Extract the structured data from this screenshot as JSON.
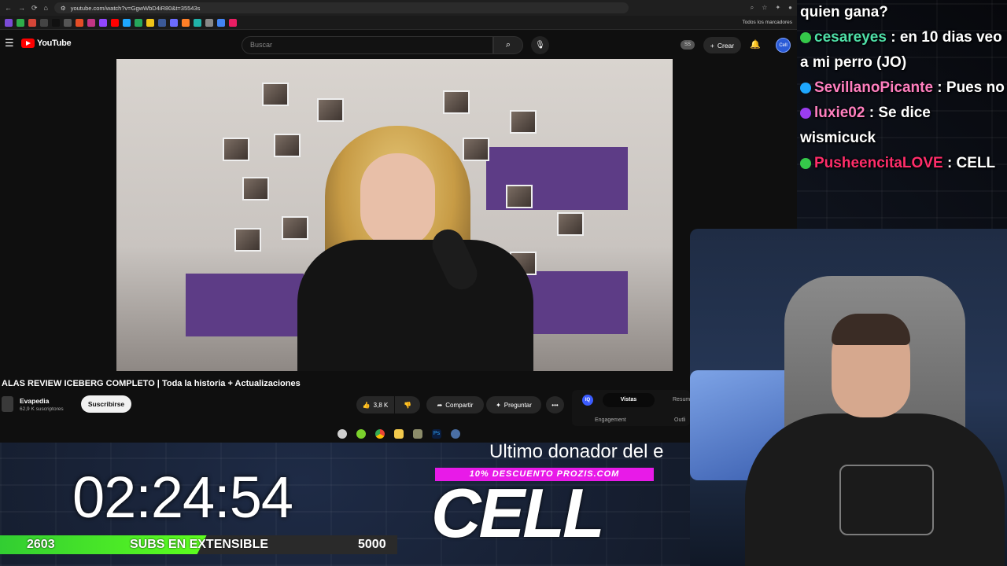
{
  "browser": {
    "url": "youtube.com/watch?v=GgwWbD4iR80&t=35543s",
    "bookmarks_folder": "Todos los marcadores"
  },
  "youtube": {
    "logo_text": "YouTube",
    "search_placeholder": "Buscar",
    "ss_badge": "SS",
    "create_label": "Crear",
    "avatar_text": "Cell"
  },
  "video": {
    "title": "ALAS REVIEW ICEBERG COMPLETO | Toda la historia + Actualizaciones",
    "channel": "Evapedia",
    "subscribers": "62,9 K suscriptores",
    "subscribe_label": "Suscribirse",
    "likes": "3,8 K",
    "share_label": "Compartir",
    "ask_label": "Preguntar",
    "more_label": "•••"
  },
  "extension": {
    "icon": "IQ",
    "tab_views": "Vistas",
    "tab_summary": "Resum",
    "engagement": "Engagement",
    "outline": "Outli"
  },
  "chat": [
    {
      "user": "",
      "message": "quien gana?",
      "color": "#ffffff",
      "badge_color": ""
    },
    {
      "user": "cesareyes",
      "message": ": en 10 dias veo a mi perro (JO)",
      "color": "#4fe0a8",
      "badge_color": "#35c94a"
    },
    {
      "user": "SevillanoPicante",
      "message": ": Pues no",
      "color": "#ff7fbf",
      "badge_color": "#1ea7ff"
    },
    {
      "user": "luxie02",
      "message": ": Se dice wismicuck",
      "color": "#ff7fbf",
      "badge_color": "#9b3df0"
    },
    {
      "user": "PusheencitaLOVE",
      "message": ": CELL",
      "color": "#ff2d6a",
      "badge_color": "#35c94a"
    }
  ],
  "overlay": {
    "donor_label": "Ultimo donador del e",
    "promo": "10% DESCUENTO PROZIS.COM",
    "donor_name": "CELL",
    "timer": "02:24:54",
    "sub_current": "2603",
    "sub_label": "SUBS EN EXTENSIBLE",
    "sub_goal": "5000",
    "sub_progress": 0.52
  },
  "colors": {
    "youtube_red": "#ff0000",
    "promo_magenta": "#e81ae8",
    "progress_green": "#32cd32"
  }
}
